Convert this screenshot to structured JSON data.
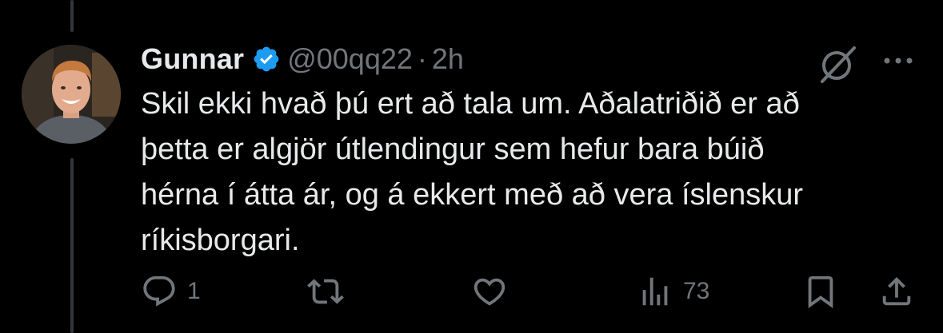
{
  "tweet": {
    "display_name": "Gunnar",
    "handle": "@00qq22",
    "separator": "·",
    "time": "2h",
    "verified": true,
    "text": "Skil ekki hvað þú ert að tala um. Aðalatriðið er að\nþetta er algjör útlendingur sem hefur bara búið\nhérna í átta ár, og á ekkert með að vera íslenskur\nríkisborgari.",
    "avatar_icon": "profile-photo",
    "top_right_icons": [
      "grok-icon",
      "more-icon"
    ]
  },
  "actions": {
    "reply": {
      "icon": "reply-icon",
      "count": "1"
    },
    "repost": {
      "icon": "repost-icon",
      "count": ""
    },
    "like": {
      "icon": "heart-icon",
      "count": ""
    },
    "views": {
      "icon": "views-icon",
      "count": "73"
    },
    "bookmark": {
      "icon": "bookmark-icon"
    },
    "share": {
      "icon": "share-icon"
    }
  },
  "colors": {
    "background": "#000000",
    "text_primary": "#e7e9ea",
    "text_secondary": "#71767b",
    "verified_blue": "#1d9bf0",
    "thread_line": "#333639"
  }
}
